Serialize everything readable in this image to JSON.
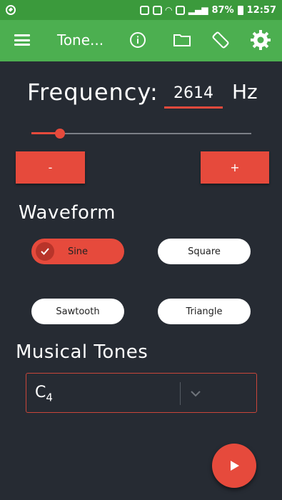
{
  "status_bar": {
    "battery": "87%",
    "time": "12:57"
  },
  "toolbar": {
    "title": "Tone...",
    "icons": [
      "menu-icon",
      "info-icon",
      "folder-icon",
      "screen-rotation-icon",
      "gear-icon"
    ]
  },
  "frequency": {
    "label": "Frequency:",
    "value": "2614",
    "unit": "Hz",
    "slider_fraction": 0.13
  },
  "buttons": {
    "minus": "-",
    "plus": "+"
  },
  "waveform": {
    "title": "Waveform",
    "options": [
      "Sine",
      "Square",
      "Sawtooth",
      "Triangle"
    ],
    "selected": "Sine"
  },
  "musical_tones": {
    "title": "Musical Tones",
    "selected_value": "C4",
    "selected_note": "C",
    "selected_octave": "4"
  },
  "play_button": {
    "icon": "play-icon"
  },
  "colors": {
    "accent": "#e64a3c",
    "toolbar": "#4caf50",
    "background": "#262b33"
  }
}
